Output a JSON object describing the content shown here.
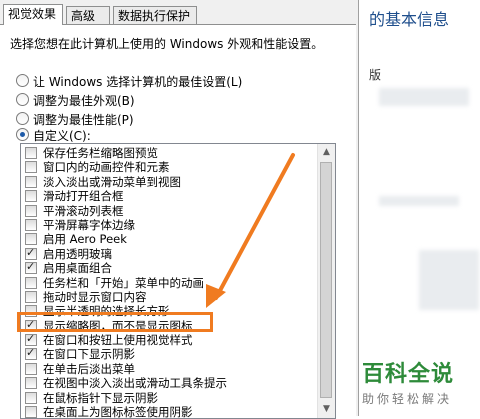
{
  "tabs": [
    {
      "label": "视觉效果",
      "active": true
    },
    {
      "label": "高级",
      "active": false
    },
    {
      "label": "数据执行保护",
      "active": false
    }
  ],
  "intro": "选择您想在此计算机上使用的 Windows 外观和性能设置。",
  "options": [
    {
      "label": "让 Windows 选择计算机的最佳设置(L)",
      "selected": false
    },
    {
      "label": "调整为最佳外观(B)",
      "selected": false
    },
    {
      "label": "调整为最佳性能(P)",
      "selected": false
    },
    {
      "label": "自定义(C):",
      "selected": true
    }
  ],
  "effects": [
    {
      "label": "保存任务栏缩略图预览",
      "checked": false
    },
    {
      "label": "窗口内的动画控件和元素",
      "checked": false
    },
    {
      "label": "淡入淡出或滑动菜单到视图",
      "checked": false
    },
    {
      "label": "滑动打开组合框",
      "checked": false
    },
    {
      "label": "平滑滚动列表框",
      "checked": false
    },
    {
      "label": "平滑屏幕字体边缘",
      "checked": false
    },
    {
      "label": "启用 Aero Peek",
      "checked": false
    },
    {
      "label": "启用透明玻璃",
      "checked": true
    },
    {
      "label": "启用桌面组合",
      "checked": true
    },
    {
      "label": "任务栏和「开始」菜单中的动画",
      "checked": false
    },
    {
      "label": "拖动时显示窗口内容",
      "checked": false
    },
    {
      "label": "显示半透明的选择长方形",
      "checked": false
    },
    {
      "label": "显示缩略图，而不是显示图标",
      "checked": true
    },
    {
      "label": "在窗口和按钮上使用视觉样式",
      "checked": true
    },
    {
      "label": "在窗口下显示阴影",
      "checked": true
    },
    {
      "label": "在单击后淡出菜单",
      "checked": false
    },
    {
      "label": "在视图中淡入淡出或滑动工具条提示",
      "checked": false
    },
    {
      "label": "在鼠标指针下显示阴影",
      "checked": false
    },
    {
      "label": "在桌面上为图标标签使用阴影",
      "checked": false
    }
  ],
  "background_window": {
    "title": "的基本信息",
    "label": "版"
  },
  "watermark": {
    "main": "百科全说",
    "sub": "助你轻松解决"
  },
  "colors": {
    "highlight": "#f07b20",
    "watermark": "#2e8b3a",
    "link": "#1e4e8c"
  }
}
